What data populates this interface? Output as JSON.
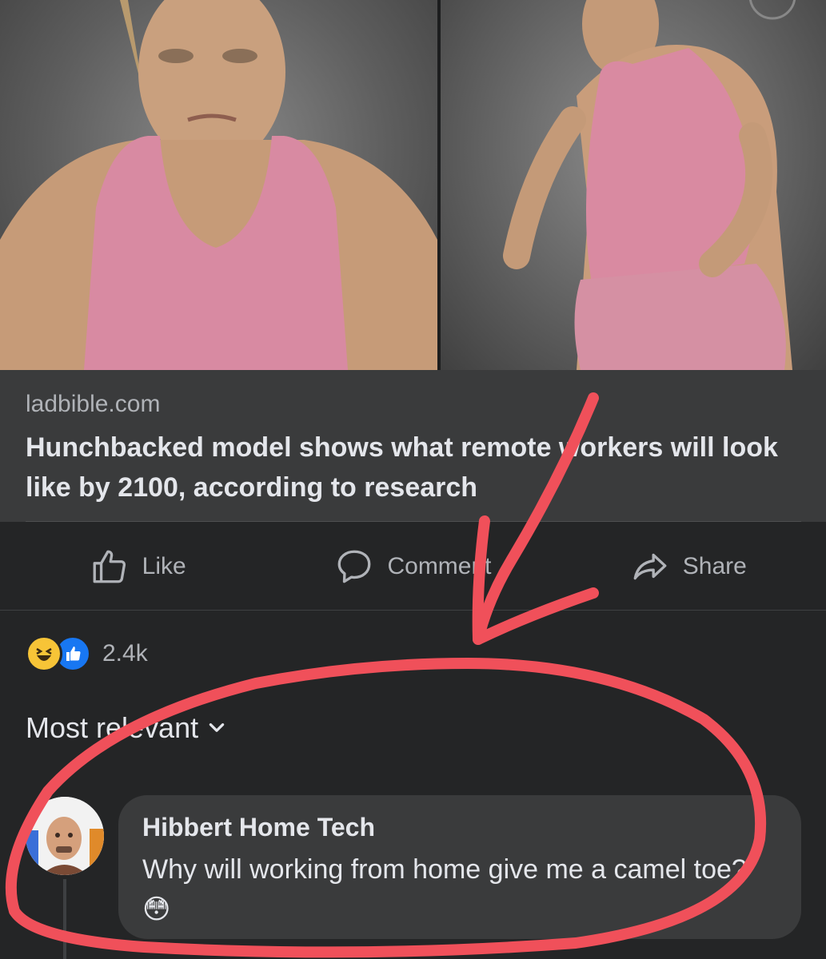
{
  "link": {
    "domain": "ladbible.com",
    "headline": "Hunchbacked model shows what remote workers will look like by 2100, according to research"
  },
  "actions": {
    "like_label": "Like",
    "comment_label": "Comment",
    "share_label": "Share"
  },
  "reactions": {
    "count": "2.4k",
    "types": [
      "haha",
      "like"
    ]
  },
  "comments": {
    "sort_label": "Most relevant",
    "items": [
      {
        "author": "Hibbert Home Tech",
        "text": "Why will working from home give me a camel toe?",
        "emoji": "😳"
      }
    ]
  },
  "icons": [
    "like-icon",
    "comment-icon",
    "share-icon",
    "chevron-down-icon",
    "haha-reaction-icon",
    "like-reaction-icon"
  ],
  "colors": {
    "background": "#242526",
    "card": "#3a3b3c",
    "secondary_text": "#b0b3b8",
    "annotation": "#f0505a",
    "like_blue": "#1877f2"
  }
}
